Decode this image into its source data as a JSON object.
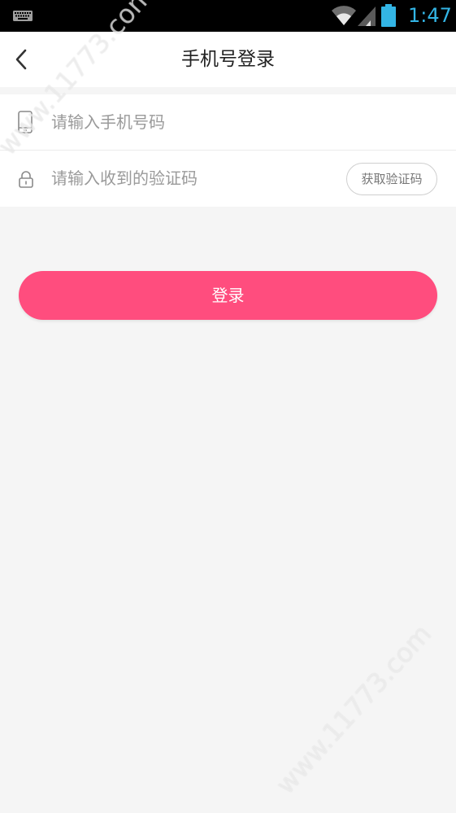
{
  "status_bar": {
    "time": "1:47",
    "icons": [
      "keyboard-icon",
      "wifi-icon",
      "signal-icon",
      "battery-icon"
    ],
    "accent_color": "#33b5e5"
  },
  "nav": {
    "back_icon": "chevron-left-icon",
    "title": "手机号登录"
  },
  "form": {
    "phone": {
      "icon": "phone-icon",
      "placeholder": "请输入手机号码",
      "value": ""
    },
    "code": {
      "icon": "lock-icon",
      "placeholder": "请输入收到的验证码",
      "value": "",
      "get_code_label": "获取验证码"
    }
  },
  "login": {
    "label": "登录",
    "color": "#ff4d7e"
  },
  "watermark": {
    "text": "www.11773.com"
  }
}
